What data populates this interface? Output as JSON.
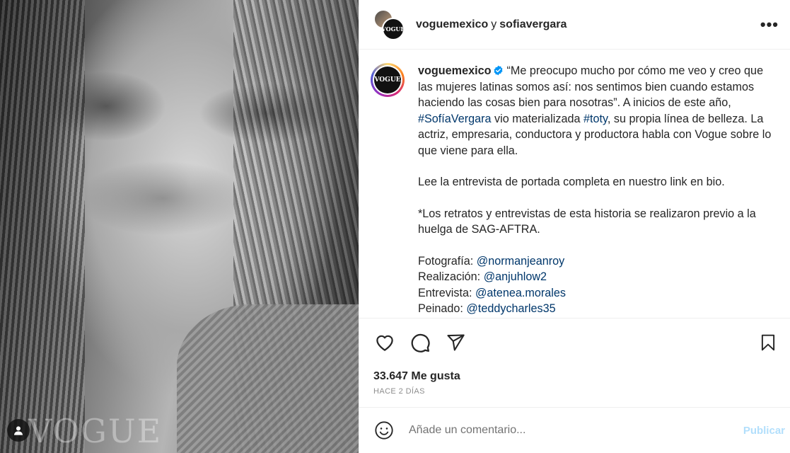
{
  "photo": {
    "watermark": "VOGUE",
    "user_tag_icon": "user-tag-icon"
  },
  "header": {
    "account1": "voguemexico",
    "separator": "y",
    "account2": "sofiavergara",
    "avatar_text": "VOGUE",
    "more_label": "•••"
  },
  "caption": {
    "avatar_text": "VOGUE",
    "username": "voguemexico",
    "verified_icon": "verified-badge-icon",
    "text_part1": "“Me preocupo mucho por cómo me veo y creo que las mujeres latinas somos así: nos sentimos bien cuando estamos haciendo las cosas bien para nosotras”. A inicios de este año, ",
    "hashtag1": "#SofíaVergara",
    "text_part2": " vio materializada ",
    "hashtag2": "#toty",
    "text_part3": ", su propia línea de belleza. La actriz, empresaria, conductora y productora habla con Vogue sobre lo que viene para ella.",
    "para2": "Lee la entrevista de portada completa en nuestro link en bio.",
    "para3": "*Los retratos y entrevistas de esta historia se realizaron previo a la huelga de SAG-AFTRA.",
    "credits": [
      {
        "label": "Fotografía: ",
        "handle": "@normanjeanroy"
      },
      {
        "label": "Realización: ",
        "handle": "@anjuhlow2"
      },
      {
        "label": "Entrevista: ",
        "handle": "@atenea.morales"
      },
      {
        "label": "Peinado: ",
        "handle": "@teddycharles35"
      }
    ]
  },
  "actions": {
    "icons": [
      "heart-icon",
      "comment-icon",
      "share-icon",
      "bookmark-icon"
    ],
    "likes": "33.647 Me gusta",
    "time": "HACE 2 DÍAS"
  },
  "comment": {
    "placeholder": "Añade un comentario...",
    "publish": "Publicar",
    "emoji_icon": "emoji-icon"
  }
}
